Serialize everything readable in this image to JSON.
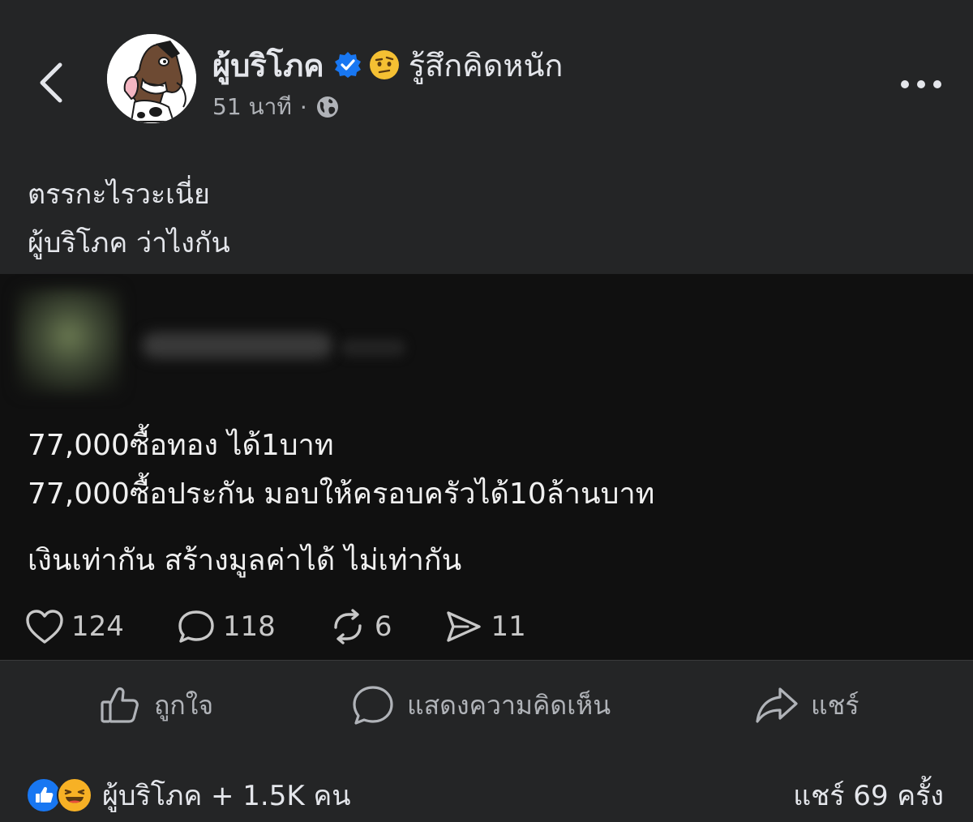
{
  "header": {
    "author_name": "ผู้บริโภค",
    "feeling": "รู้สึกคิดหนัก",
    "time": "51 นาที",
    "separator": "·",
    "icons": {
      "back": "chevron-left-icon",
      "verified": "verified-badge-icon",
      "feeling_emoji": "thinking-face-icon",
      "privacy": "globe-icon",
      "more": "more-dots-icon"
    }
  },
  "caption": {
    "line1": "ตรรกะไรวะเนี่ย",
    "line2": "ผู้บริโภค ว่าไงกัน"
  },
  "embedded_post": {
    "lines": [
      "77,000ซื้อทอง ได้1บาท",
      "77,000ซื้อประกัน มอบให้ครอบครัวได้10ล้านบาท",
      "เงินเท่ากัน สร้างมูลค่าได้ ไม่เท่ากัน"
    ],
    "stats": {
      "likes": "124",
      "comments": "118",
      "reposts": "6",
      "shares": "11"
    }
  },
  "actions": {
    "like": "ถูกใจ",
    "comment": "แสดงความคิดเห็น",
    "share": "แชร์"
  },
  "footer": {
    "reactions_text": "ผู้บริโภค + 1.5K คน",
    "share_count": "แชร์ 69 ครั้ง"
  },
  "colors": {
    "background": "#242526",
    "embed_background": "#101010",
    "verified_blue": "#1877f2",
    "text_primary": "#e4e6eb",
    "text_secondary": "#b0b3b8"
  }
}
